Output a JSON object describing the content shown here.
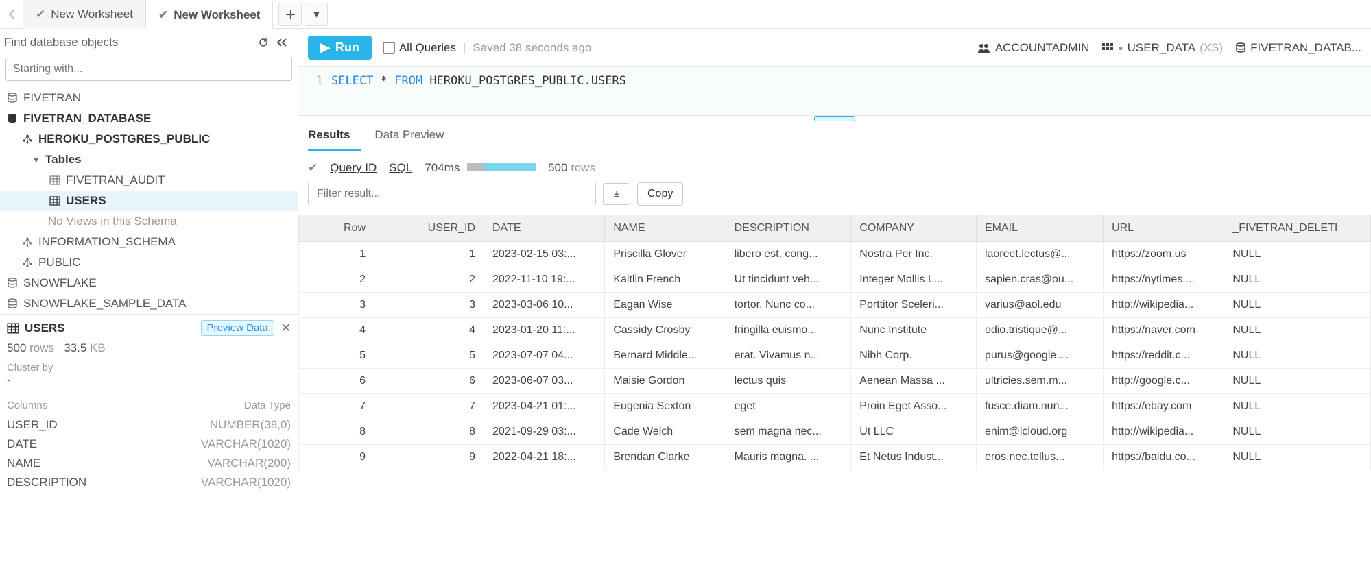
{
  "tabs": [
    {
      "label": "New Worksheet",
      "active": false
    },
    {
      "label": "New Worksheet",
      "active": true
    }
  ],
  "sidebar": {
    "find_label": "Find database objects",
    "search_placeholder": "Starting with...",
    "tree": {
      "fivetran": "FIVETRAN",
      "fivetran_database": "FIVETRAN_DATABASE",
      "heroku_schema": "HEROKU_POSTGRES_PUBLIC",
      "tables_label": "Tables",
      "fivetran_audit": "FIVETRAN_AUDIT",
      "users": "USERS",
      "no_views": "No Views in this Schema",
      "information_schema": "INFORMATION_SCHEMA",
      "public": "PUBLIC",
      "snowflake": "SNOWFLAKE",
      "snowflake_sample": "SNOWFLAKE_SAMPLE_DATA"
    },
    "meta": {
      "table_name": "USERS",
      "preview_label": "Preview Data",
      "rows_count": "500",
      "rows_word": "rows",
      "size": "33.5",
      "size_unit": "KB",
      "cluster_label": "Cluster by",
      "cluster_value": "-",
      "columns_label": "Columns",
      "datatype_label": "Data Type",
      "columns": [
        {
          "name": "USER_ID",
          "type": "NUMBER(38,0)"
        },
        {
          "name": "DATE",
          "type": "VARCHAR(1020)"
        },
        {
          "name": "NAME",
          "type": "VARCHAR(200)"
        },
        {
          "name": "DESCRIPTION",
          "type": "VARCHAR(1020)"
        }
      ]
    }
  },
  "toolbar": {
    "run_label": "Run",
    "all_queries_label": "All Queries",
    "saved_label": "Saved 38 seconds ago"
  },
  "context": {
    "role": "ACCOUNTADMIN",
    "warehouse": "USER_DATA",
    "warehouse_size": "(XS)",
    "database": "FIVETRAN_DATAB..."
  },
  "editor": {
    "line_no": "1",
    "kw_select": "SELECT",
    "star": " * ",
    "kw_from": "FROM",
    "rest": " HEROKU_POSTGRES_PUBLIC.USERS"
  },
  "results": {
    "tab_results": "Results",
    "tab_preview": "Data Preview",
    "query_id": "Query ID",
    "sql_link": "SQL",
    "timing": "704ms",
    "row_count": "500",
    "rows_word": "rows",
    "filter_placeholder": "Filter result...",
    "copy_label": "Copy",
    "headers": [
      "Row",
      "USER_ID",
      "DATE",
      "NAME",
      "DESCRIPTION",
      "COMPANY",
      "EMAIL",
      "URL",
      "_FIVETRAN_DELETI"
    ],
    "rows": [
      {
        "row": "1",
        "user_id": "1",
        "date": "2023-02-15 03:...",
        "name": "Priscilla Glover",
        "desc": "libero est, cong...",
        "company": "Nostra Per Inc.",
        "email": "laoreet.lectus@...",
        "url": "https://zoom.us",
        "del": "NULL"
      },
      {
        "row": "2",
        "user_id": "2",
        "date": "2022-11-10 19:...",
        "name": "Kaitlin French",
        "desc": "Ut tincidunt veh...",
        "company": "Integer Mollis L...",
        "email": "sapien.cras@ou...",
        "url": "https://nytimes....",
        "del": "NULL"
      },
      {
        "row": "3",
        "user_id": "3",
        "date": "2023-03-06 10...",
        "name": "Eagan Wise",
        "desc": "tortor. Nunc co...",
        "company": "Porttitor Sceleri...",
        "email": "varius@aol.edu",
        "url": "http://wikipedia...",
        "del": "NULL"
      },
      {
        "row": "4",
        "user_id": "4",
        "date": "2023-01-20 11:...",
        "name": "Cassidy Crosby",
        "desc": "fringilla euismo...",
        "company": "Nunc Institute",
        "email": "odio.tristique@...",
        "url": "https://naver.com",
        "del": "NULL"
      },
      {
        "row": "5",
        "user_id": "5",
        "date": "2023-07-07 04...",
        "name": "Bernard Middle...",
        "desc": "erat. Vivamus n...",
        "company": "Nibh Corp.",
        "email": "purus@google....",
        "url": "https://reddit.c...",
        "del": "NULL"
      },
      {
        "row": "6",
        "user_id": "6",
        "date": "2023-06-07 03...",
        "name": "Maisie Gordon",
        "desc": "lectus quis",
        "company": "Aenean Massa ...",
        "email": "ultricies.sem.m...",
        "url": "http://google.c...",
        "del": "NULL"
      },
      {
        "row": "7",
        "user_id": "7",
        "date": "2023-04-21 01:...",
        "name": "Eugenia Sexton",
        "desc": "eget",
        "company": "Proin Eget Asso...",
        "email": "fusce.diam.nun...",
        "url": "https://ebay.com",
        "del": "NULL"
      },
      {
        "row": "8",
        "user_id": "8",
        "date": "2021-09-29 03:...",
        "name": "Cade Welch",
        "desc": "sem magna nec...",
        "company": "Ut LLC",
        "email": "enim@icloud.org",
        "url": "http://wikipedia...",
        "del": "NULL"
      },
      {
        "row": "9",
        "user_id": "9",
        "date": "2022-04-21 18:...",
        "name": "Brendan Clarke",
        "desc": "Mauris magna. ...",
        "company": "Et Netus Indust...",
        "email": "eros.nec.tellus...",
        "url": "https://baidu.co...",
        "del": "NULL"
      }
    ]
  }
}
